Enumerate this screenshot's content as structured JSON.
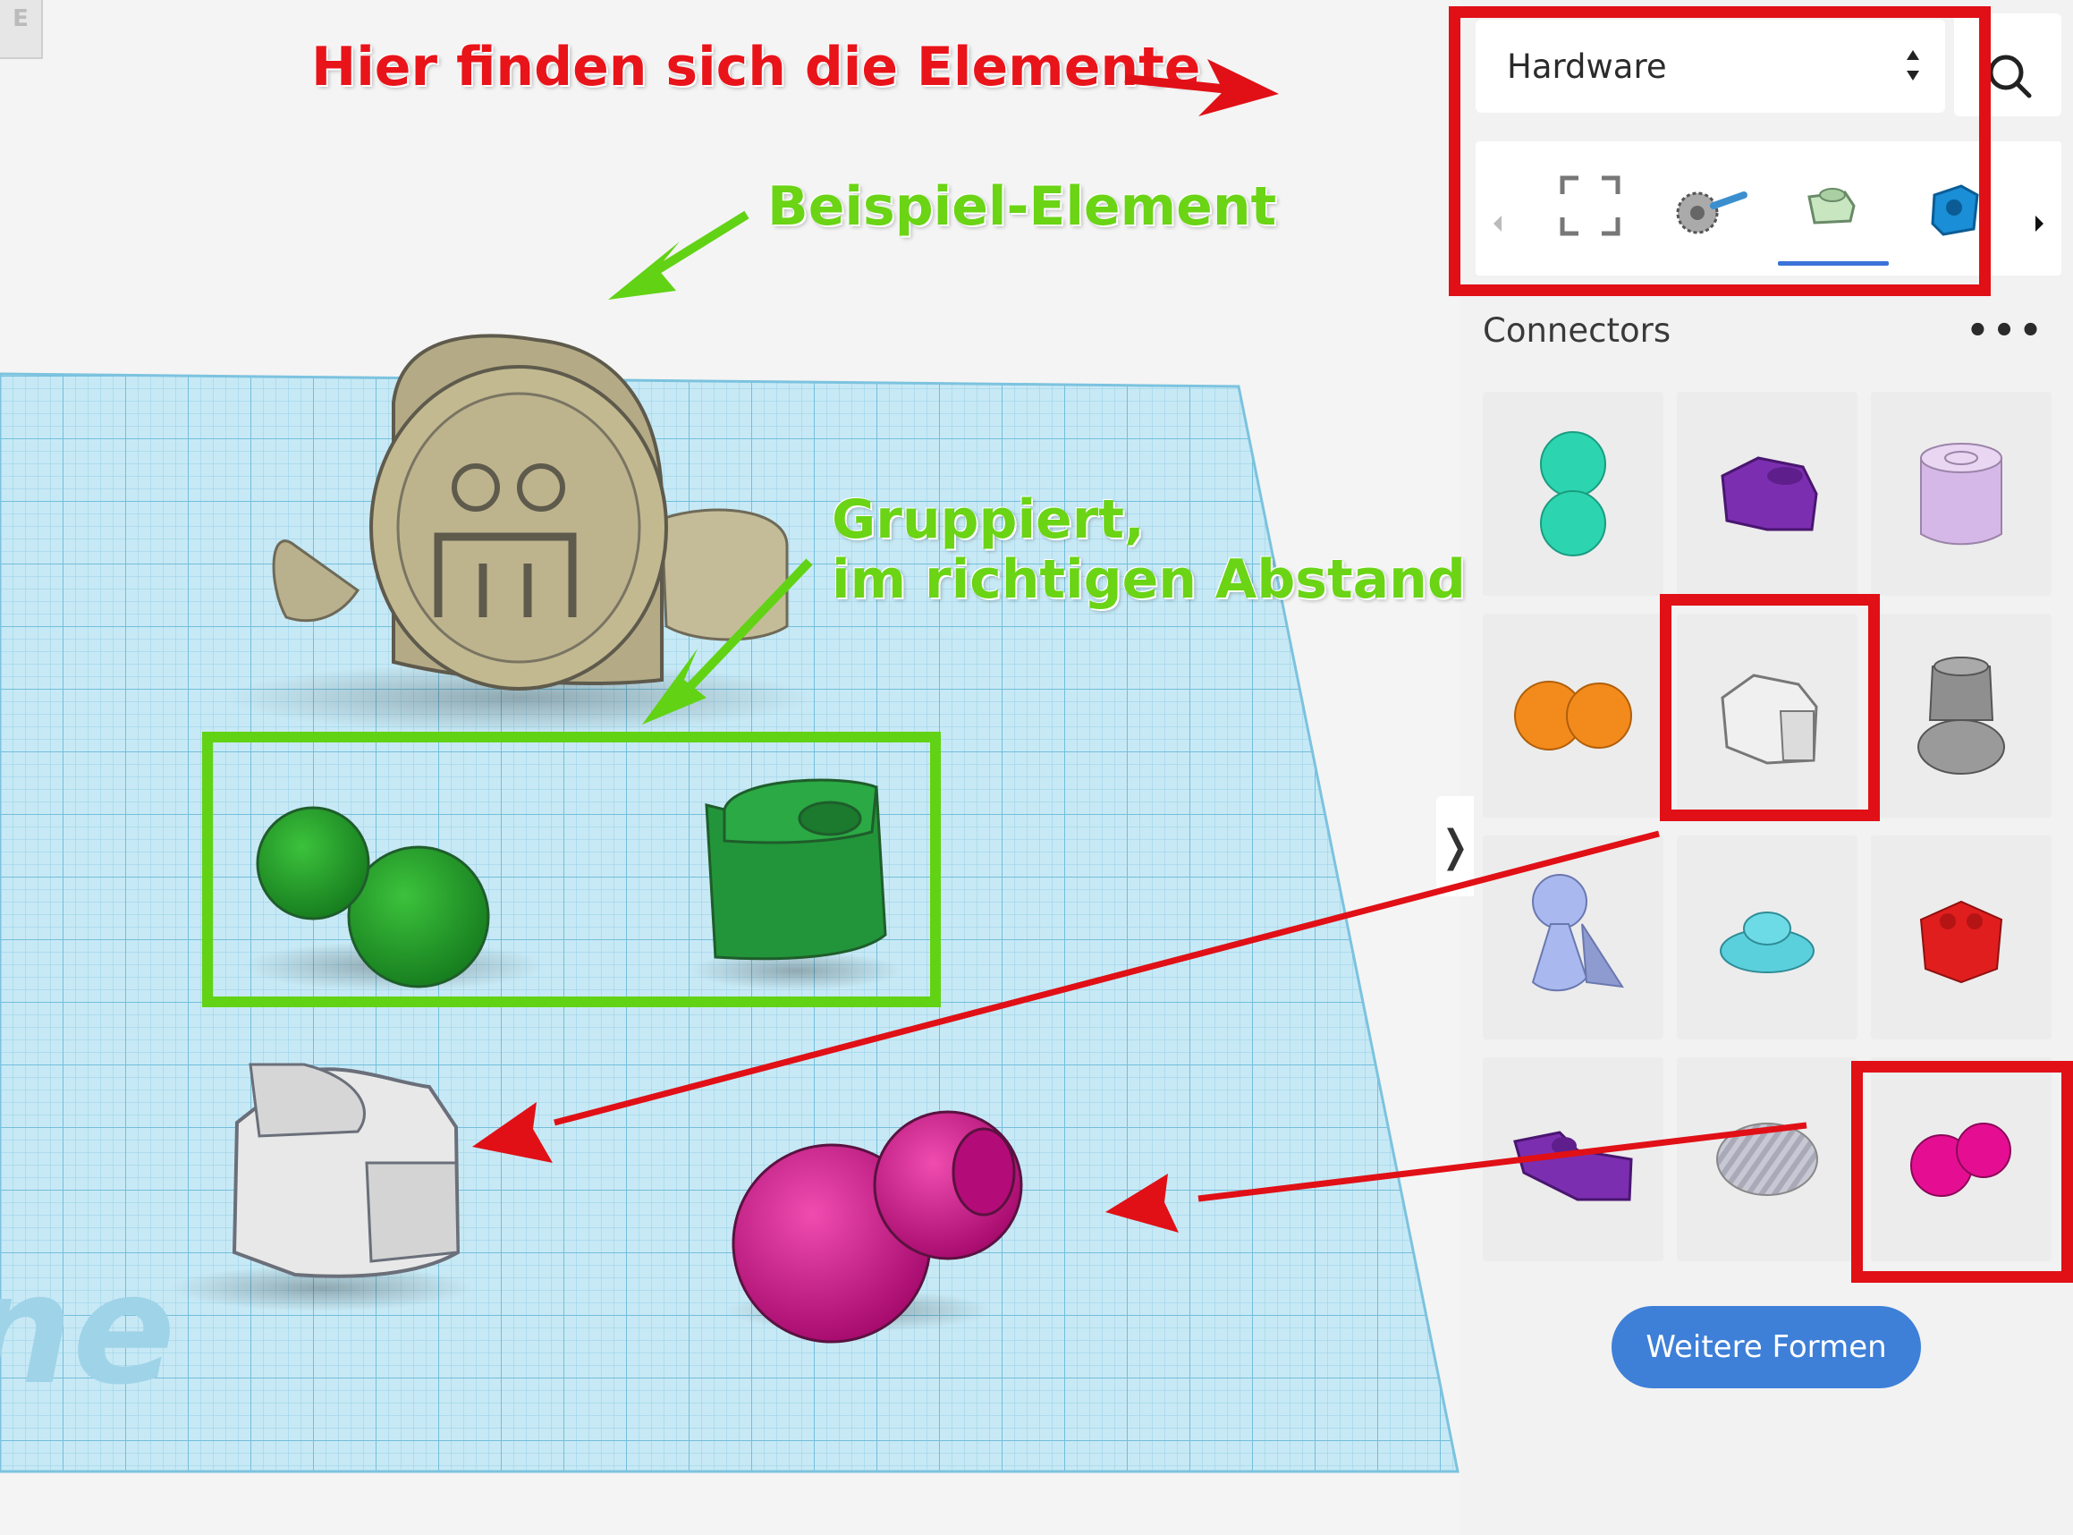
{
  "annotations": {
    "elements_hint": "Hier finden sich die Elemente",
    "example_element": "Beispiel-Element",
    "grouped_line1": "Gruppiert,",
    "grouped_line2": "im richtigen Abstand"
  },
  "sidebar": {
    "category_select": {
      "value": "Hardware"
    },
    "shape_tabs": [
      {
        "icon": "frame-brackets-icon",
        "selected": false
      },
      {
        "icon": "gear-part-icon",
        "selected": false
      },
      {
        "icon": "connector-part-icon",
        "selected": true
      },
      {
        "icon": "blue-block-icon",
        "selected": false
      }
    ],
    "section_title": "Connectors",
    "more_menu": "•••",
    "shapes": [
      {
        "name": "ball-joint-teal",
        "color": "#2cd5b0"
      },
      {
        "name": "clip-connector-purple",
        "color": "#7b2fb0"
      },
      {
        "name": "cap-lilac",
        "color": "#d6b8e8"
      },
      {
        "name": "double-ball-orange",
        "color": "#f38a1c"
      },
      {
        "name": "clip-connector-white",
        "color": "#f0f0f0"
      },
      {
        "name": "socket-gray",
        "color": "#8f8f8f"
      },
      {
        "name": "ball-stand-lavender",
        "color": "#a9b8ee"
      },
      {
        "name": "round-base-cyan",
        "color": "#5ad0dc"
      },
      {
        "name": "lego-piece-red",
        "color": "#e01e1e"
      },
      {
        "name": "clip-connector-purple-2",
        "color": "#7b2fb0"
      },
      {
        "name": "striped-dome-gray",
        "color": "#b8b8c8"
      },
      {
        "name": "double-ball-magenta",
        "color": "#e50e92"
      }
    ],
    "more_shapes_button": "Weitere Formen"
  },
  "workplane_logo": "ne",
  "corner_label": "E",
  "colors": {
    "annotation_red": "#e8141a",
    "annotation_green": "#6ad415",
    "grid": "#a8d8ea",
    "accent_blue": "#3e7fd8"
  }
}
